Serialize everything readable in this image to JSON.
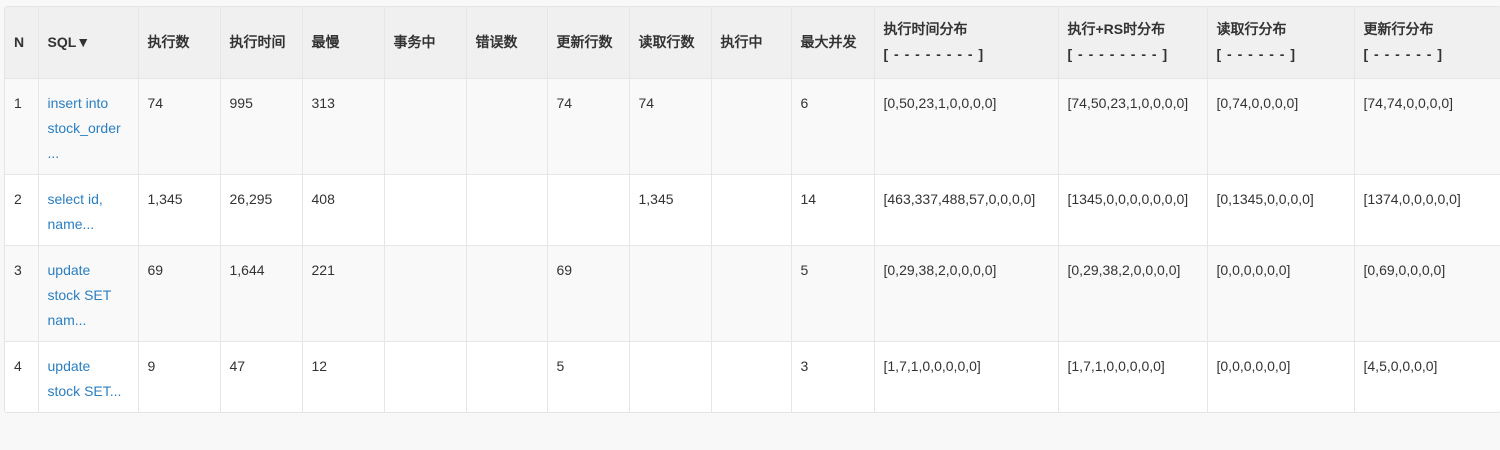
{
  "headers": [
    {
      "main": "N",
      "sub": ""
    },
    {
      "main": "SQL▼",
      "sub": ""
    },
    {
      "main": "执行数",
      "sub": ""
    },
    {
      "main": "执行时间",
      "sub": ""
    },
    {
      "main": "最慢",
      "sub": ""
    },
    {
      "main": "事务中",
      "sub": ""
    },
    {
      "main": "错误数",
      "sub": ""
    },
    {
      "main": "更新行数",
      "sub": ""
    },
    {
      "main": "读取行数",
      "sub": ""
    },
    {
      "main": "执行中",
      "sub": ""
    },
    {
      "main": "最大并发",
      "sub": ""
    },
    {
      "main": "执行时间分布",
      "sub": "[ - - - - - - - - ]"
    },
    {
      "main": "执行+RS时分布",
      "sub": "[ - - - - - - - - ]"
    },
    {
      "main": "读取行分布",
      "sub": "[ - - - - - - ]"
    },
    {
      "main": "更新行分布",
      "sub": "[ - - - - - - ]"
    }
  ],
  "rows": [
    {
      "n": "1",
      "sql_lines": [
        "insert into",
        "stock_order",
        "..."
      ],
      "exec_count": "74",
      "exec_time": "995",
      "slowest": "313",
      "in_txn": "",
      "errors": "",
      "update_rows": "74",
      "read_rows": "74",
      "running": "",
      "max_concurrent": "6",
      "exec_time_dist": "[0,50,23,1,0,0,0,0]",
      "exec_rs_dist": "[74,50,23,1,0,0,0,0]",
      "read_dist": "[0,74,0,0,0,0]",
      "update_dist": "[74,74,0,0,0,0]"
    },
    {
      "n": "2",
      "sql_lines": [
        "select id,",
        "name..."
      ],
      "exec_count": "1,345",
      "exec_time": "26,295",
      "slowest": "408",
      "in_txn": "",
      "errors": "",
      "update_rows": "",
      "read_rows": "1,345",
      "running": "",
      "max_concurrent": "14",
      "exec_time_dist": "[463,337,488,57,0,0,0,0]",
      "exec_rs_dist": "[1345,0,0,0,0,0,0,0]",
      "read_dist": "[0,1345,0,0,0,0]",
      "update_dist": "[1374,0,0,0,0,0]"
    },
    {
      "n": "3",
      "sql_lines": [
        "update",
        "stock SET",
        "nam..."
      ],
      "exec_count": "69",
      "exec_time": "1,644",
      "slowest": "221",
      "in_txn": "",
      "errors": "",
      "update_rows": "69",
      "read_rows": "",
      "running": "",
      "max_concurrent": "5",
      "exec_time_dist": "[0,29,38,2,0,0,0,0]",
      "exec_rs_dist": "[0,29,38,2,0,0,0,0]",
      "read_dist": "[0,0,0,0,0,0]",
      "update_dist": "[0,69,0,0,0,0]"
    },
    {
      "n": "4",
      "sql_lines": [
        "update",
        "stock SET..."
      ],
      "exec_count": "9",
      "exec_time": "47",
      "slowest": "12",
      "in_txn": "",
      "errors": "",
      "update_rows": "5",
      "read_rows": "",
      "running": "",
      "max_concurrent": "3",
      "exec_time_dist": "[1,7,1,0,0,0,0,0]",
      "exec_rs_dist": "[1,7,1,0,0,0,0,0]",
      "read_dist": "[0,0,0,0,0,0]",
      "update_dist": "[4,5,0,0,0,0]"
    }
  ]
}
